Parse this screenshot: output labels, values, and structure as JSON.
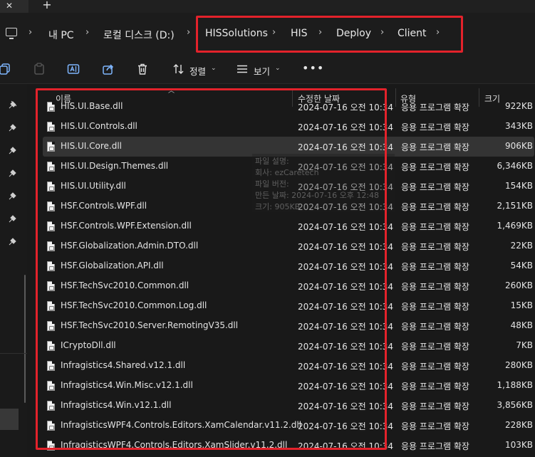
{
  "tabs": {
    "close_glyph": "✕",
    "new_glyph": "+"
  },
  "breadcrumb": [
    {
      "label": "내 PC"
    },
    {
      "label": "로컬 디스크 (D:)"
    },
    {
      "label": "HISSolutions"
    },
    {
      "label": "HIS"
    },
    {
      "label": "Deploy"
    },
    {
      "label": "Client"
    }
  ],
  "commandbar": {
    "sort_label": "정렬",
    "view_label": "보기",
    "more_label": "•••"
  },
  "columns": {
    "name": "이름",
    "date": "수정한 날짜",
    "type": "유형",
    "size": "크기"
  },
  "rows": [
    {
      "name": "HIS.UI.Base.dll",
      "date": "2024-07-16 오전 10:34",
      "type": "응용 프로그램 확장",
      "size": "922KB"
    },
    {
      "name": "HIS.UI.Controls.dll",
      "date": "2024-07-16 오전 10:34",
      "type": "응용 프로그램 확장",
      "size": "343KB"
    },
    {
      "name": "HIS.UI.Core.dll",
      "date": "2024-07-16 오전 10:34",
      "type": "응용 프로그램 확장",
      "size": "906KB"
    },
    {
      "name": "HIS.UI.Design.Themes.dll",
      "date": "2024-07-16 오전 10:34",
      "type": "응용 프로그램 확장",
      "size": "6,346KB"
    },
    {
      "name": "HIS.UI.Utility.dll",
      "date": "2024-07-16 오전 10:34",
      "type": "응용 프로그램 확장",
      "size": "154KB"
    },
    {
      "name": "HSF.Controls.WPF.dll",
      "date": "2024-07-16 오전 10:34",
      "type": "응용 프로그램 확장",
      "size": "2,151KB"
    },
    {
      "name": "HSF.Controls.WPF.Extension.dll",
      "date": "2024-07-16 오전 10:34",
      "type": "응용 프로그램 확장",
      "size": "1,469KB"
    },
    {
      "name": "HSF.Globalization.Admin.DTO.dll",
      "date": "2024-07-16 오전 10:34",
      "type": "응용 프로그램 확장",
      "size": "22KB"
    },
    {
      "name": "HSF.Globalization.API.dll",
      "date": "2024-07-16 오전 10:34",
      "type": "응용 프로그램 확장",
      "size": "54KB"
    },
    {
      "name": "HSF.TechSvc2010.Common.dll",
      "date": "2024-07-16 오전 10:34",
      "type": "응용 프로그램 확장",
      "size": "260KB"
    },
    {
      "name": "HSF.TechSvc2010.Common.Log.dll",
      "date": "2024-07-16 오전 10:34",
      "type": "응용 프로그램 확장",
      "size": "15KB"
    },
    {
      "name": "HSF.TechSvc2010.Server.RemotingV35.dll",
      "date": "2024-07-16 오전 10:34",
      "type": "응용 프로그램 확장",
      "size": "48KB"
    },
    {
      "name": "ICryptoDll.dll",
      "date": "2024-07-16 오전 10:34",
      "type": "응용 프로그램 확장",
      "size": "7KB"
    },
    {
      "name": "Infragistics4.Shared.v12.1.dll",
      "date": "2024-07-16 오전 10:34",
      "type": "응용 프로그램 확장",
      "size": "280KB"
    },
    {
      "name": "Infragistics4.Win.Misc.v12.1.dll",
      "date": "2024-07-16 오전 10:34",
      "type": "응용 프로그램 확장",
      "size": "1,188KB"
    },
    {
      "name": "Infragistics4.Win.v12.1.dll",
      "date": "2024-07-16 오전 10:34",
      "type": "응용 프로그램 확장",
      "size": "3,856KB"
    },
    {
      "name": "InfragisticsWPF4.Controls.Editors.XamCalendar.v11.2.dll",
      "date": "2024-07-16 오전 10:34",
      "type": "응용 프로그램 확장",
      "size": "228KB"
    },
    {
      "name": "InfragisticsWPF4.Controls.Editors.XamSlider.v11.2.dll",
      "date": "2024-07-16 오전 10:34",
      "type": "응용 프로그램 확장",
      "size": "103KB"
    }
  ],
  "tooltip": {
    "lines": [
      "파일 설명: ",
      "회사: ezCaretech",
      "파일 버전: ",
      "만든 날짜: 2024-07-16 오후 12:48",
      "크기: 905KB"
    ]
  },
  "colors": {
    "highlight": "#e3222b",
    "selected_row": "#343434",
    "background": "#191919"
  }
}
